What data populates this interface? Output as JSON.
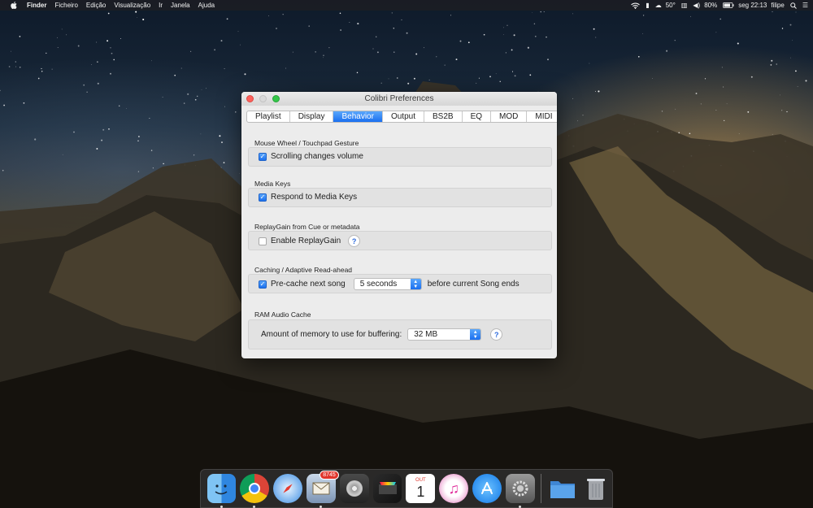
{
  "menubar": {
    "app_name": "Finder",
    "items": [
      "Ficheiro",
      "Edição",
      "Visualização",
      "Ir",
      "Janela",
      "Ajuda"
    ],
    "temperature": "50°",
    "battery": "80%",
    "clock": "seg 22:13",
    "user": "filipe"
  },
  "window": {
    "title": "Colibri Preferences",
    "tabs": [
      "Playlist",
      "Display",
      "Behavior",
      "Output",
      "BS2B",
      "EQ",
      "MOD",
      "MIDI"
    ],
    "active_tab": "Behavior",
    "sections": {
      "mouse_wheel": {
        "title": "Mouse Wheel / Touchpad Gesture",
        "checkbox_label": "Scrolling changes volume",
        "checked": true
      },
      "media_keys": {
        "title": "Media Keys",
        "checkbox_label": "Respond to Media Keys",
        "checked": true
      },
      "replaygain": {
        "title": "ReplayGain from Cue or metadata",
        "checkbox_label": "Enable ReplayGain",
        "checked": false,
        "help": "?"
      },
      "caching": {
        "title": "Caching / Adaptive Read-ahead",
        "checkbox_label": "Pre-cache next song",
        "checked": true,
        "popup_value": "5 seconds",
        "suffix": "before current Song ends"
      },
      "ram_cache": {
        "title": "RAM Audio Cache",
        "label": "Amount of memory to use for buffering:",
        "popup_value": "32 MB",
        "help": "?"
      }
    }
  },
  "dock": {
    "mail_badge": "8745",
    "calendar_month": "OUT",
    "calendar_day": "1",
    "apps": [
      "finder-icon",
      "chrome-icon",
      "safari-icon",
      "mail-icon",
      "disk-utility-icon",
      "final-cut-pro-icon",
      "calendar-icon",
      "itunes-icon",
      "app-store-icon",
      "system-preferences-icon",
      "folder-icon",
      "trash-icon"
    ]
  }
}
